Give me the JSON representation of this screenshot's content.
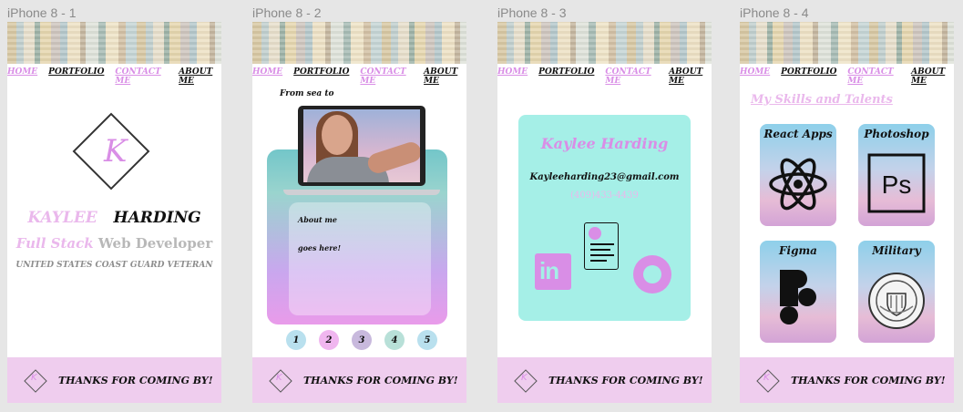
{
  "artboards": [
    {
      "title": "iPhone 8 - 1"
    },
    {
      "title": "iPhone 8 - 2"
    },
    {
      "title": "iPhone 8 - 3"
    },
    {
      "title": "iPhone 8 - 4"
    }
  ],
  "nav": {
    "home": "HOME",
    "portfolio": "PORTFOLIO",
    "contact": "CONTACT ME",
    "about": "ABOUT ME"
  },
  "footer": {
    "text": "THANKS FOR COMING BY!",
    "logo_letter": "K"
  },
  "home": {
    "logo_letter": "K",
    "first_name": "KAYLEE",
    "last_name": "HARDING",
    "role_a": "Full Stack",
    "role_b": "Web Developer",
    "veteran": "UNITED STATES COAST GUARD  VETERAN"
  },
  "portfolio": {
    "sea_text": "From sea to",
    "about_line1": "About me",
    "about_line2": "goes here!",
    "pages": [
      "1",
      "2",
      "3",
      "4",
      "5"
    ],
    "page_colors": [
      "#b9e0ee",
      "#f0b6ef",
      "#c8b9dd",
      "#b8e0d8",
      "#b9e0ee"
    ]
  },
  "contact": {
    "name": "Kaylee Harding",
    "email": "Kayleeharding23@gmail.com",
    "phone": "(409)433-4439",
    "linkedin_icon": "linkedin-icon",
    "resume_icon": "resume-icon",
    "github_icon": "github-icon"
  },
  "skills": {
    "title": "My Skills and Talents",
    "tiles": [
      {
        "label": "React Apps",
        "icon": "react-icon"
      },
      {
        "label": "Photoshop",
        "icon": "photoshop-icon",
        "glyph": "Ps"
      },
      {
        "label": "Figma",
        "icon": "figma-icon"
      },
      {
        "label": "Military",
        "icon": "coast-guard-seal-icon"
      }
    ]
  },
  "colors": {
    "pink": "#d98ee6",
    "light_pink": "#eab8ec",
    "footer_bg": "#efcdee",
    "mint": "#a5efe7"
  }
}
